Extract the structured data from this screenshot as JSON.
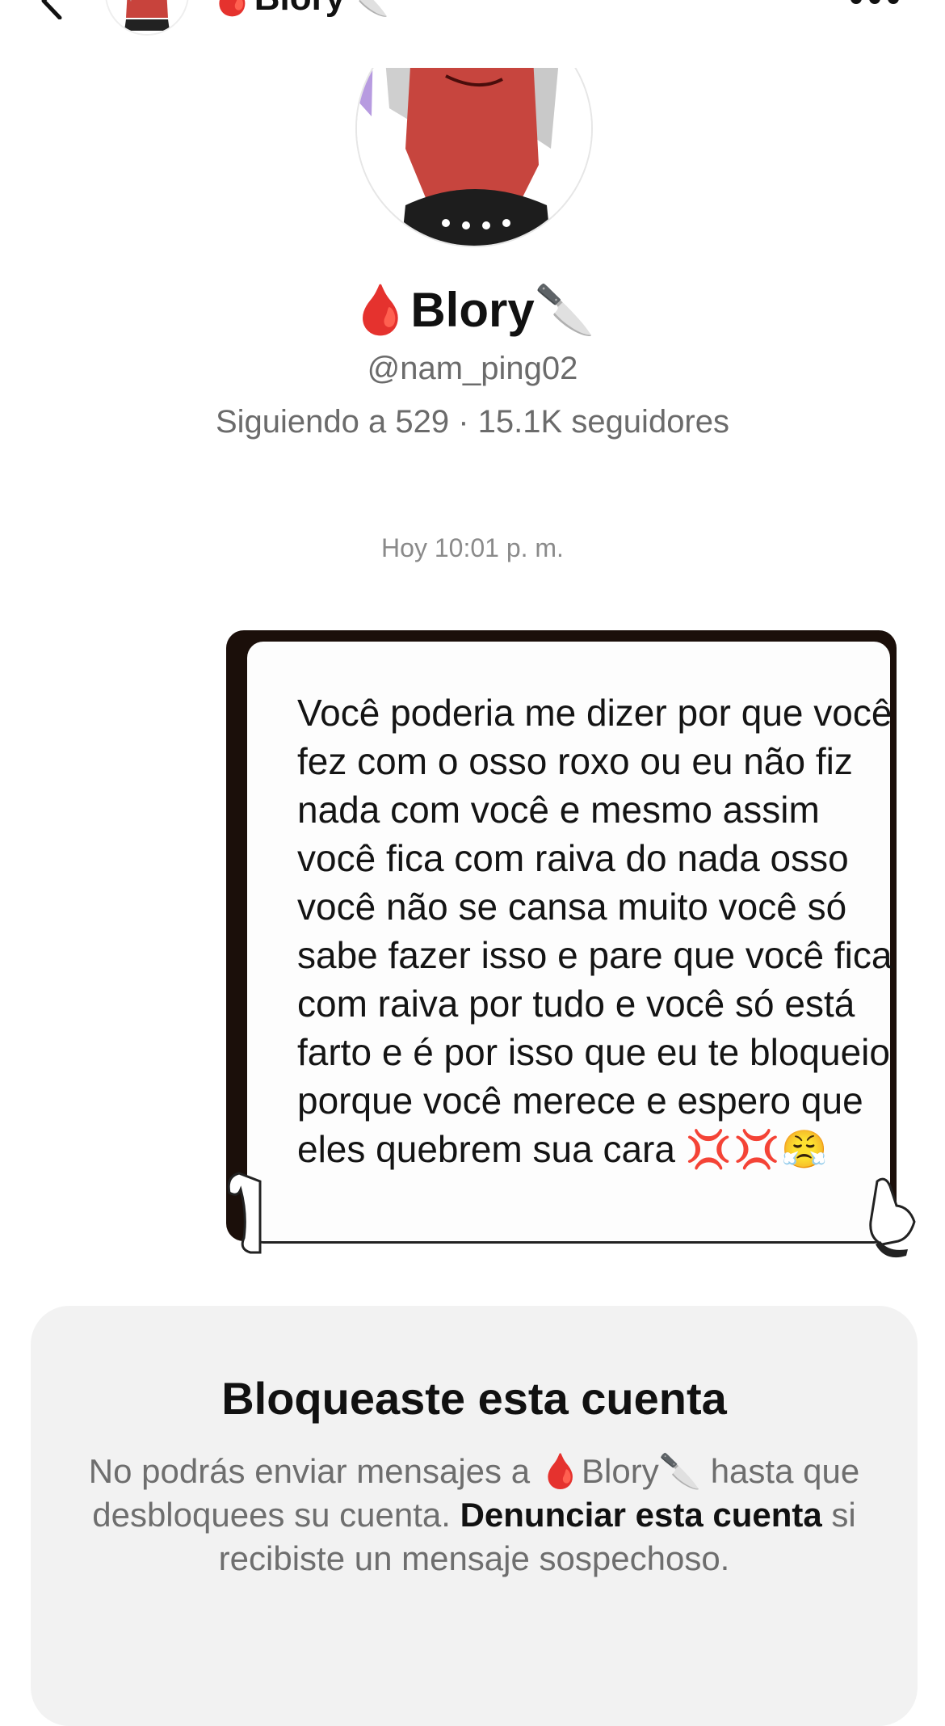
{
  "nav": {
    "username": "🩸Blory🔪"
  },
  "profile": {
    "display_name": "Blory",
    "name_prefix_emoji": "🩸",
    "name_suffix_emoji": "🔪",
    "handle": "@nam_ping02",
    "stats": "Siguiendo a 529 · 15.1K seguidores"
  },
  "chat": {
    "timestamp": "Hoy 10:01 p. m.",
    "message": {
      "text": "Você poderia me dizer por que você fez com o osso roxo ou eu não fiz nada com você e mesmo assim você fica com raiva do nada osso você não se cansa muito você só sabe fazer isso e pare que você fica com raiva por tudo e você só está farto e é por isso que eu te bloqueio porque você merece e espero que eles quebrem sua cara",
      "emojis": "💢💢😤"
    }
  },
  "blocked": {
    "title": "Bloqueaste esta cuenta",
    "desc_part1": "No podrás enviar mensajes a",
    "desc_name": "🩸Blory🔪",
    "desc_part2": "hasta que desbloquees su cuenta.",
    "report_link": "Denunciar esta cuenta",
    "desc_part3": "si recibiste un mensaje sospechoso."
  },
  "colors": {
    "muted_text": "#6b6b6b",
    "card_bg": "#f2f2f2",
    "blood_red": "#d0101a",
    "bubble_border": "#1b0f0a"
  }
}
